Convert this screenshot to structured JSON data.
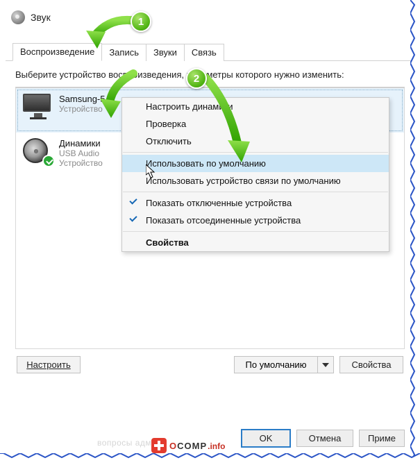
{
  "window": {
    "title": "Звук"
  },
  "tabs": {
    "playback": "Воспроизведение",
    "record": "Запись",
    "sounds": "Звуки",
    "comm": "Связь"
  },
  "instruction": "Выберите устройство воспроизведения, параметры которого нужно изменить:",
  "devices": {
    "d0": {
      "name": "Samsung-5",
      "line1": "Устройство"
    },
    "d1": {
      "name": "Динамики",
      "line1": "USB Audio",
      "line2": "Устройство"
    }
  },
  "ctx": {
    "configure": "Настроить динамики",
    "test": "Проверка",
    "disable": "Отключить",
    "set_default": "Использовать по умолчанию",
    "set_default_comm": "Использовать устройство связи по умолчанию",
    "show_disabled": "Показать отключенные устройства",
    "show_disconnected": "Показать отсоединенные устройства",
    "properties": "Свойства"
  },
  "buttons": {
    "configure": "Настроить",
    "default_split": "По умолчанию",
    "properties": "Свойства",
    "ok": "OK",
    "cancel": "Отмена",
    "apply": "Приме"
  },
  "badges": {
    "b1": "1",
    "b2": "2"
  },
  "watermark": {
    "brand": "OCOMP",
    "suffix": ".info"
  },
  "wm_faint": "вопросы админу"
}
